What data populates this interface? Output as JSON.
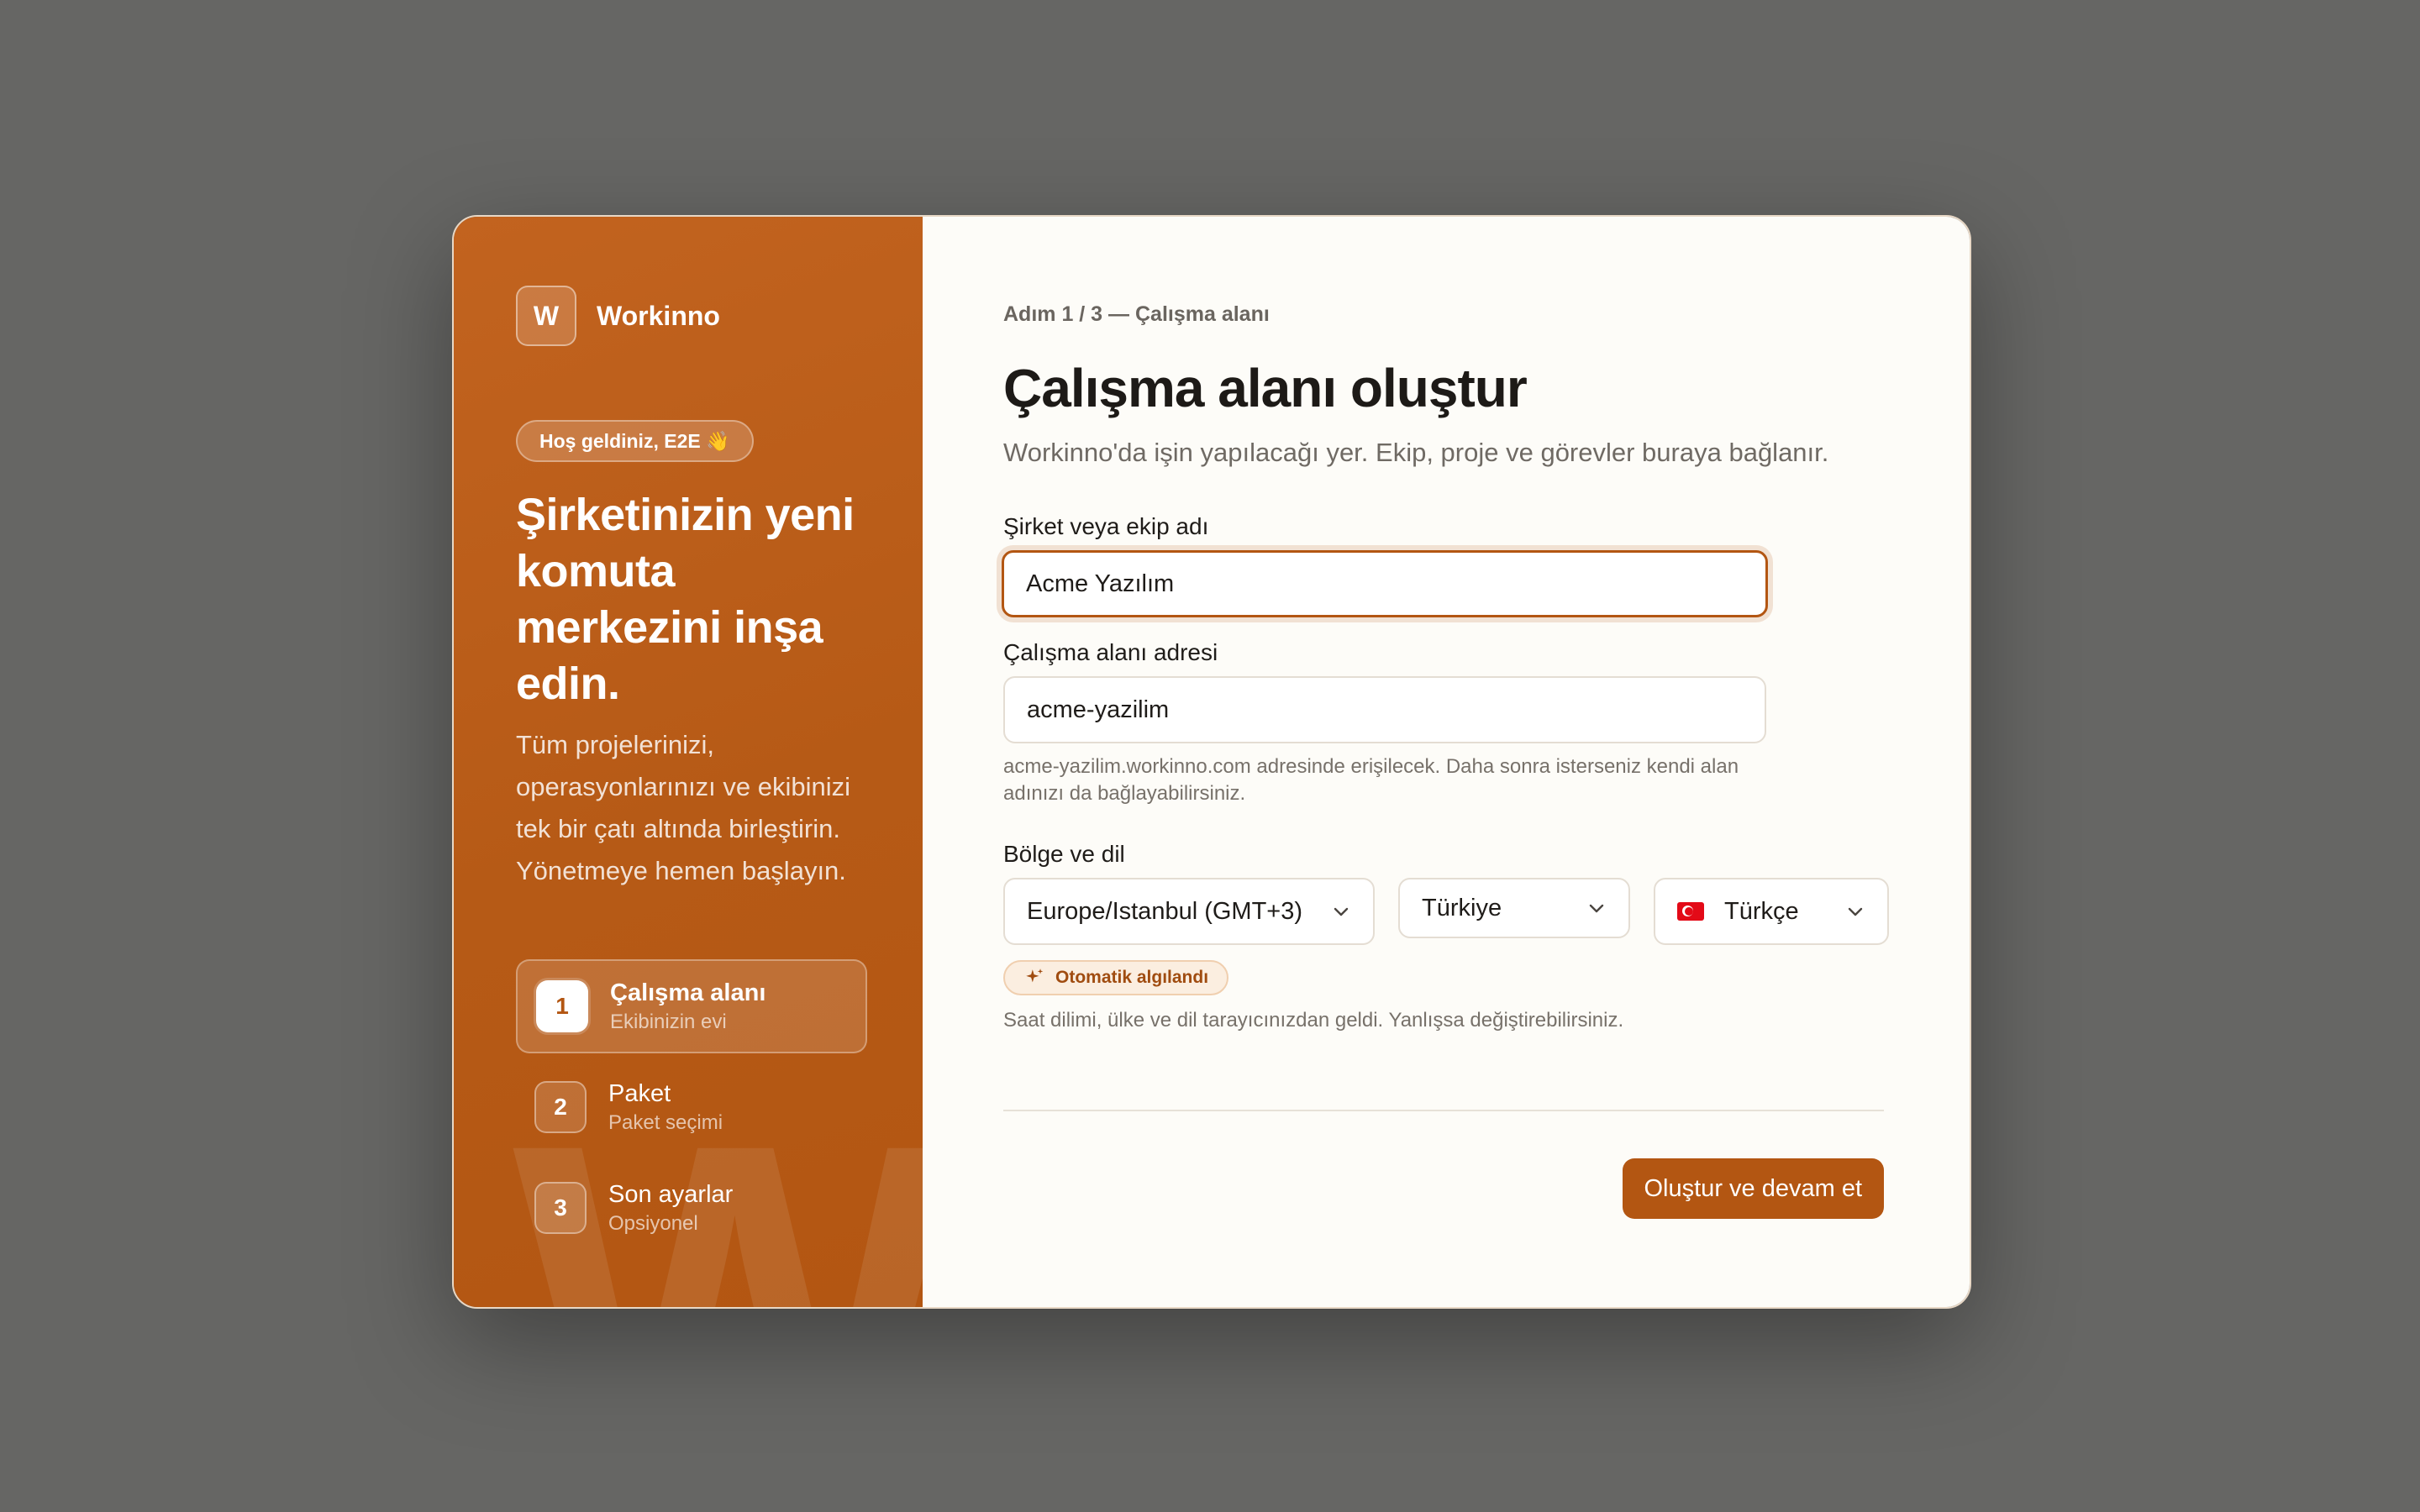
{
  "brand": {
    "logo_letter": "W",
    "name": "Workinno"
  },
  "left": {
    "welcome_badge": "Hoş geldiniz, E2E 👋",
    "headline": "Şirketinizin yeni komuta merkezini inşa edin.",
    "intro": "Tüm projelerinizi, operasyonlarınızı ve ekibinizi tek bir çatı altında birleştirin. Yönetmeye hemen başlayın.",
    "watermark": "W",
    "steps": [
      {
        "num": "1",
        "title": "Çalışma alanı",
        "subtitle": "Ekibinizin evi",
        "active": true
      },
      {
        "num": "2",
        "title": "Paket",
        "subtitle": "Paket seçimi",
        "active": false
      },
      {
        "num": "3",
        "title": "Son ayarlar",
        "subtitle": "Opsiyonel",
        "active": false
      }
    ]
  },
  "form": {
    "breadcrumb": "Adım 1 / 3 — Çalışma alanı",
    "title": "Çalışma alanı oluştur",
    "subtitle": "Workinno'da işin yapılacağı yer. Ekip, proje ve görevler buraya bağlanır.",
    "company": {
      "label": "Şirket veya ekip adı",
      "value": "Acme Yazılım"
    },
    "address": {
      "label": "Çalışma alanı adresi",
      "value": "acme-yazilim",
      "hint": "acme-yazilim.workinno.com adresinde erişilecek. Daha sonra isterseniz kendi alan adınızı da bağlayabilirsiniz."
    },
    "region": {
      "label": "Bölge ve dil",
      "timezone": "Europe/Istanbul (GMT+3)",
      "country": "Türkiye",
      "language": "Türkçe",
      "auto_badge": "Otomatik algılandı",
      "note": "Saat dilimi, ülke ve dil tarayıcınızdan geldi. Yanlışsa değiştirebilirsiniz."
    },
    "submit_label": "Oluştur ve devam et"
  },
  "colors": {
    "accent": "#b35612",
    "backdrop": "#666664",
    "panel": "#fdfcf8"
  }
}
